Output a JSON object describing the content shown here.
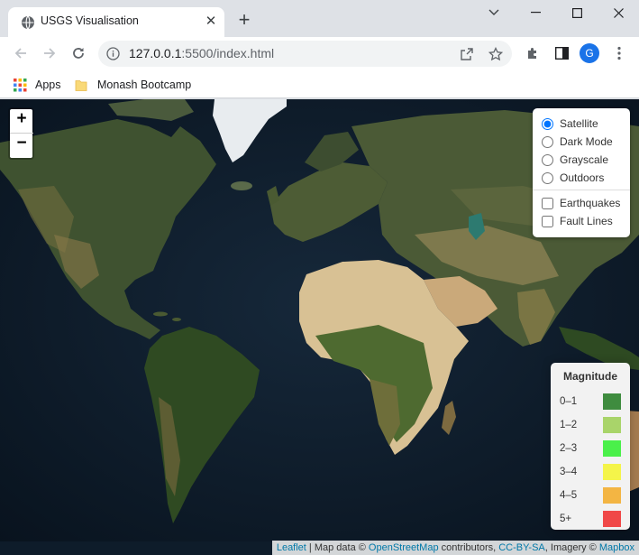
{
  "tab": {
    "title": "USGS Visualisation"
  },
  "address_bar": {
    "host": "127.0.0.1",
    "rest": ":5500/index.html"
  },
  "profile": {
    "initial": "G"
  },
  "bookmarks": [
    {
      "label": "Apps",
      "icon": "apps-grid-icon"
    },
    {
      "label": "Monash Bootcamp",
      "icon": "folder-icon"
    }
  ],
  "map": {
    "zoom_in": "+",
    "zoom_out": "−",
    "base_layers": [
      {
        "label": "Satellite",
        "checked": true
      },
      {
        "label": "Dark Mode",
        "checked": false
      },
      {
        "label": "Grayscale",
        "checked": false
      },
      {
        "label": "Outdoors",
        "checked": false
      }
    ],
    "overlays": [
      {
        "label": "Earthquakes",
        "checked": false
      },
      {
        "label": "Fault Lines",
        "checked": false
      }
    ]
  },
  "legend": {
    "title": "Magnitude",
    "items": [
      {
        "label": "0–1",
        "color": "#3f8c3f"
      },
      {
        "label": "1–2",
        "color": "#a9d46a"
      },
      {
        "label": "2–3",
        "color": "#4af04a"
      },
      {
        "label": "3–4",
        "color": "#f4f44a"
      },
      {
        "label": "4–5",
        "color": "#f3b543"
      },
      {
        "label": "5+",
        "color": "#f04848"
      }
    ]
  },
  "attribution": {
    "leaflet": "Leaflet",
    "sep1": " | Map data © ",
    "osm": "OpenStreetMap",
    "mid": " contributors, ",
    "license": "CC-BY-SA",
    "mid2": ", Imagery © ",
    "mapbox": "Mapbox"
  }
}
